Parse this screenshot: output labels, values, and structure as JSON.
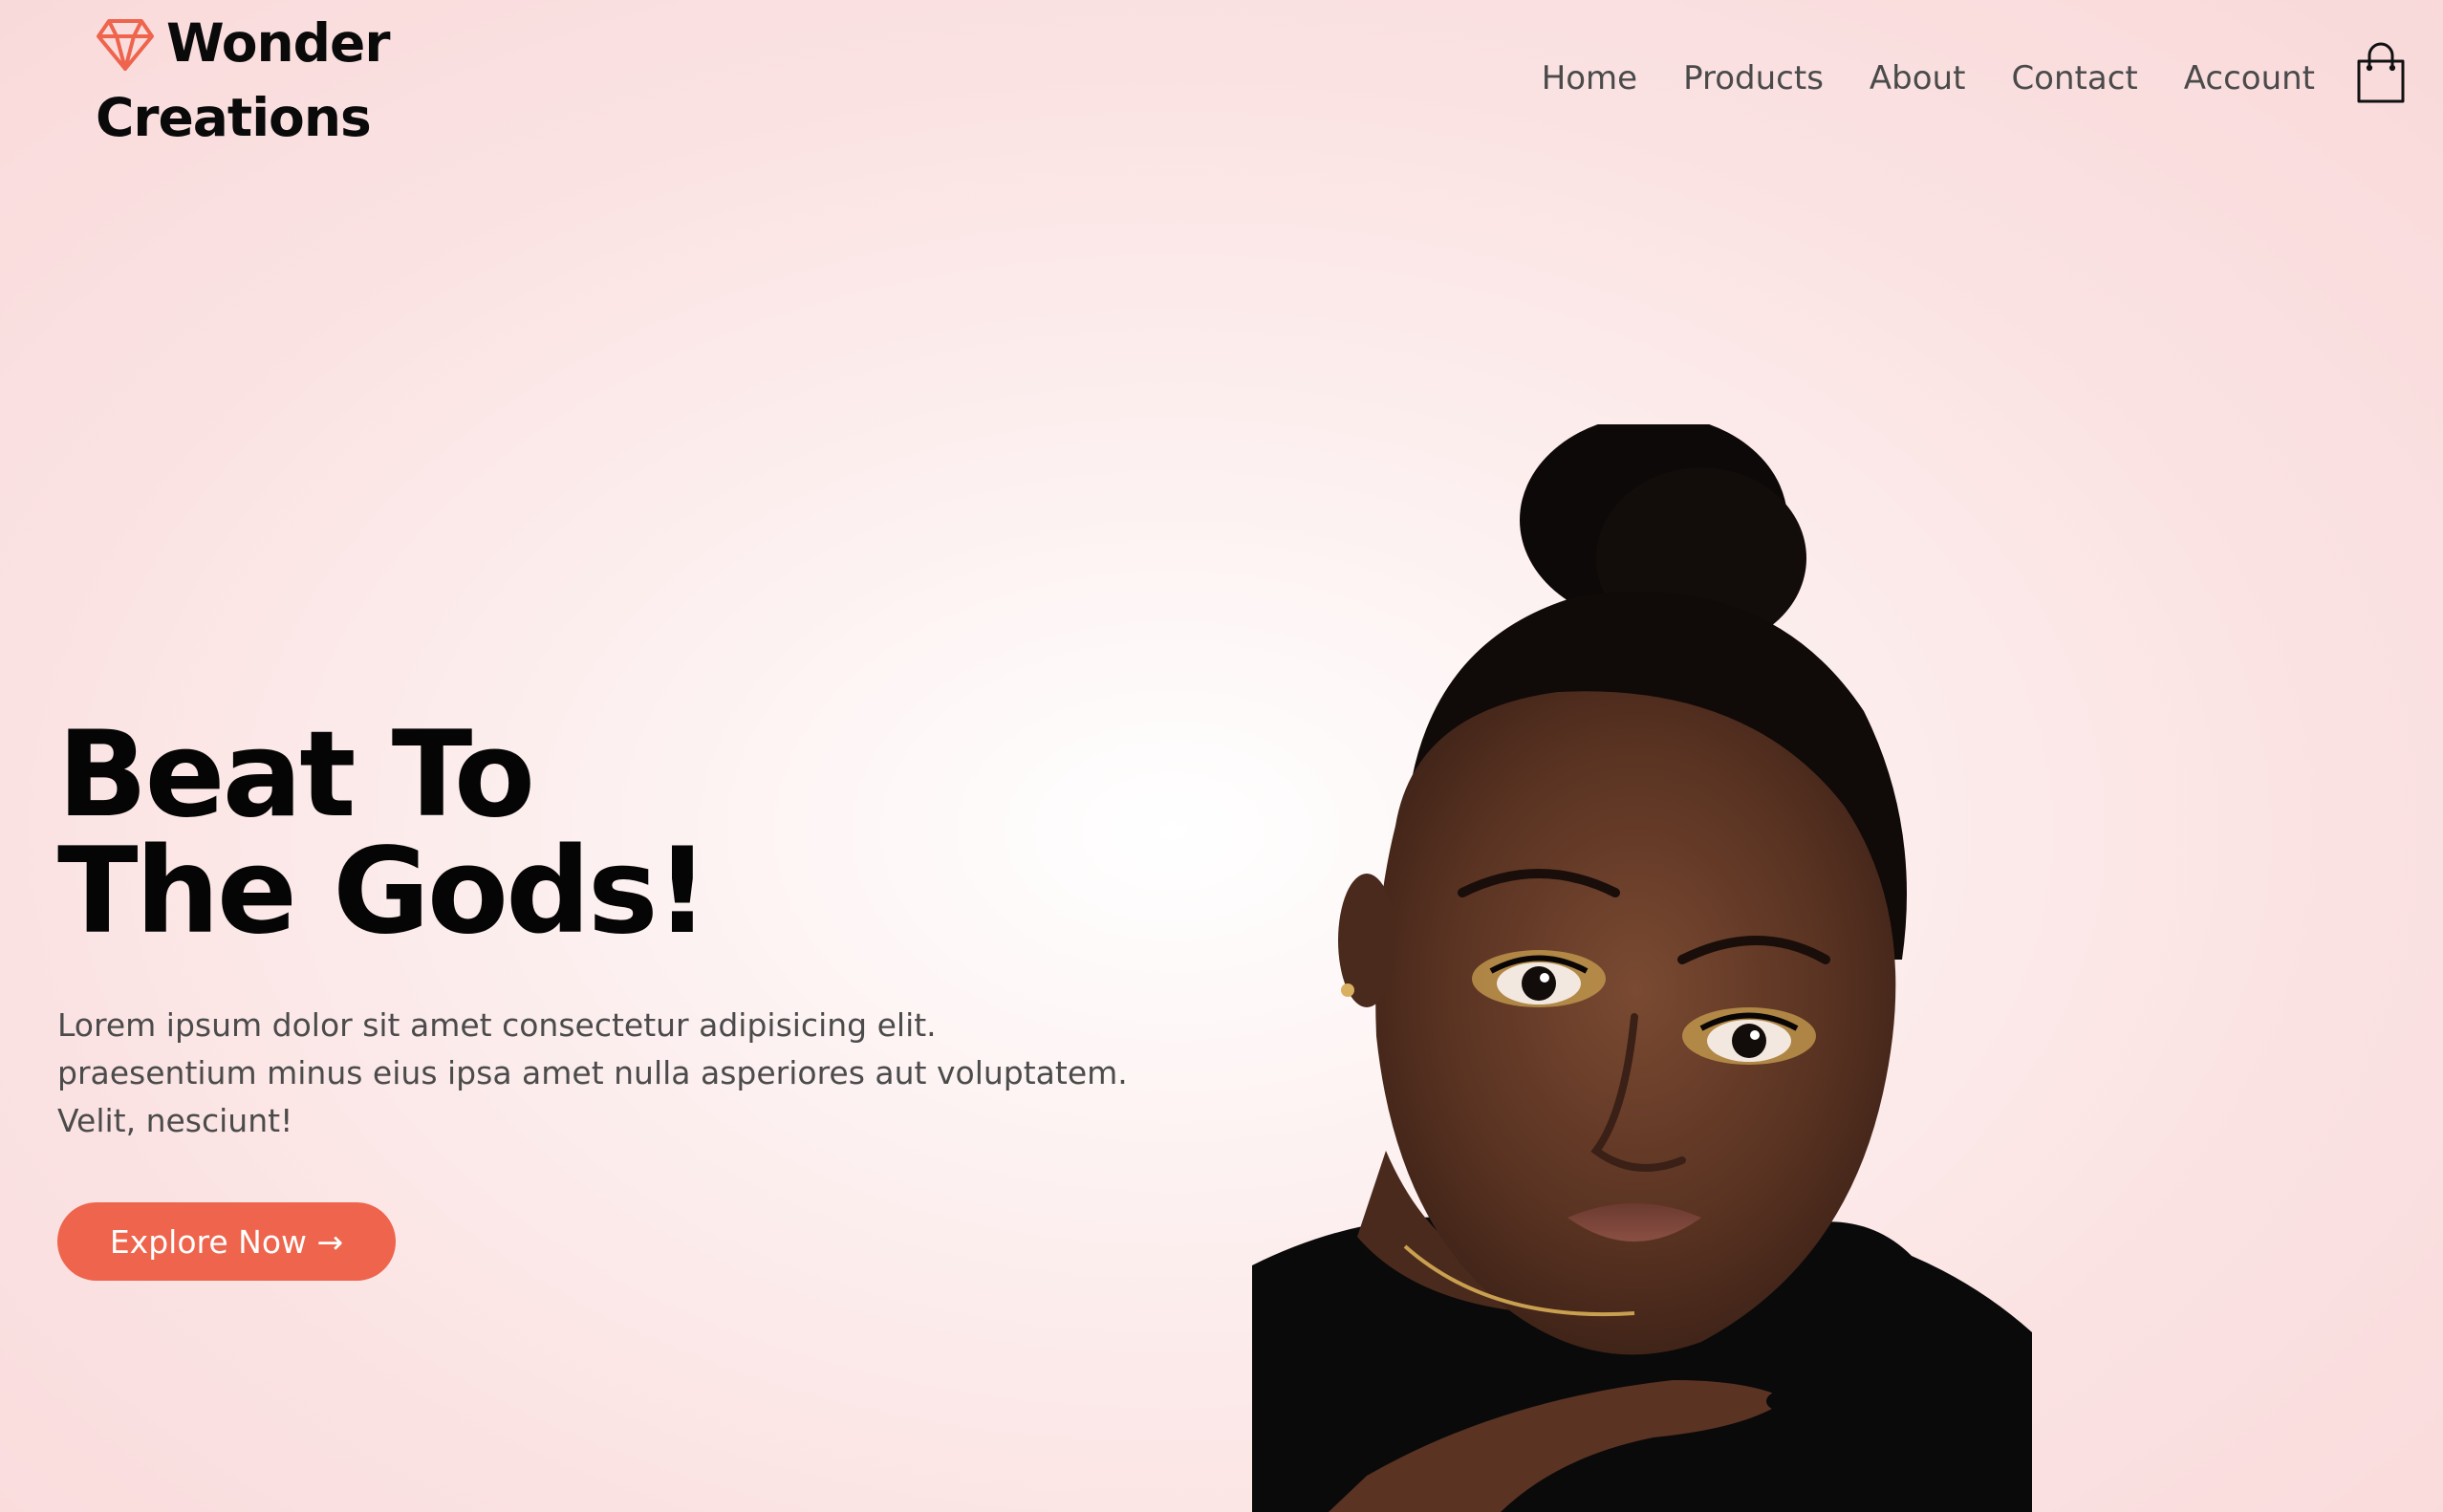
{
  "brand": {
    "name_line1": "Wonder",
    "name_line2": "Creations",
    "icon": "diamond-icon",
    "accent_color": "#ee644c"
  },
  "nav": {
    "items": [
      {
        "label": "Home"
      },
      {
        "label": "Products"
      },
      {
        "label": "About"
      },
      {
        "label": "Contact"
      },
      {
        "label": "Account"
      }
    ],
    "cart_icon": "shopping-bag-icon"
  },
  "hero": {
    "title_line1": "Beat To",
    "title_line2": "The Gods!",
    "description_lines": [
      "Lorem ipsum dolor sit amet consectetur adipisicing elit.",
      "praesentium minus eius ipsa amet nulla asperiores aut voluptatem.",
      "Velit, nesciunt!"
    ],
    "cta_label": "Explore Now →",
    "image": "portrait-of-woman"
  }
}
